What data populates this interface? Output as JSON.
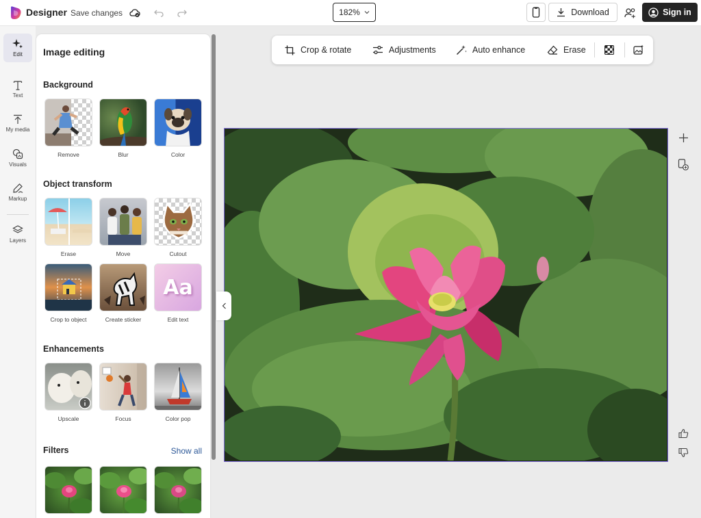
{
  "header": {
    "app_name": "Designer",
    "save_label": "Save changes",
    "zoom_level": "182%",
    "download_label": "Download",
    "signin_label": "Sign in"
  },
  "rail": {
    "items": [
      {
        "label": "Edit",
        "icon": "sparkle-icon"
      },
      {
        "label": "Text",
        "icon": "text-icon"
      },
      {
        "label": "My media",
        "icon": "upload-icon"
      },
      {
        "label": "Visuals",
        "icon": "visuals-icon"
      },
      {
        "label": "Markup",
        "icon": "pen-icon"
      },
      {
        "label": "Layers",
        "icon": "layers-icon"
      }
    ]
  },
  "panel": {
    "title": "Image editing",
    "background": {
      "title": "Background",
      "items": [
        {
          "label": "Remove"
        },
        {
          "label": "Blur"
        },
        {
          "label": "Color"
        }
      ]
    },
    "object_transform": {
      "title": "Object transform",
      "items": [
        {
          "label": "Erase"
        },
        {
          "label": "Move"
        },
        {
          "label": "Cutout"
        },
        {
          "label": "Crop to object"
        },
        {
          "label": "Create sticker"
        },
        {
          "label": "Edit text"
        }
      ]
    },
    "enhancements": {
      "title": "Enhancements",
      "items": [
        {
          "label": "Upscale"
        },
        {
          "label": "Focus"
        },
        {
          "label": "Color pop"
        }
      ]
    },
    "filters": {
      "title": "Filters",
      "show_all": "Show all"
    },
    "edit_text_glyph": "Aa"
  },
  "toolbar": {
    "crop_label": "Crop & rotate",
    "adjustments_label": "Adjustments",
    "auto_enhance_label": "Auto enhance",
    "erase_label": "Erase"
  },
  "colors": {
    "accent": "#7b68d8",
    "brand_pink": "#e3457f",
    "signin_bg": "#242424"
  }
}
